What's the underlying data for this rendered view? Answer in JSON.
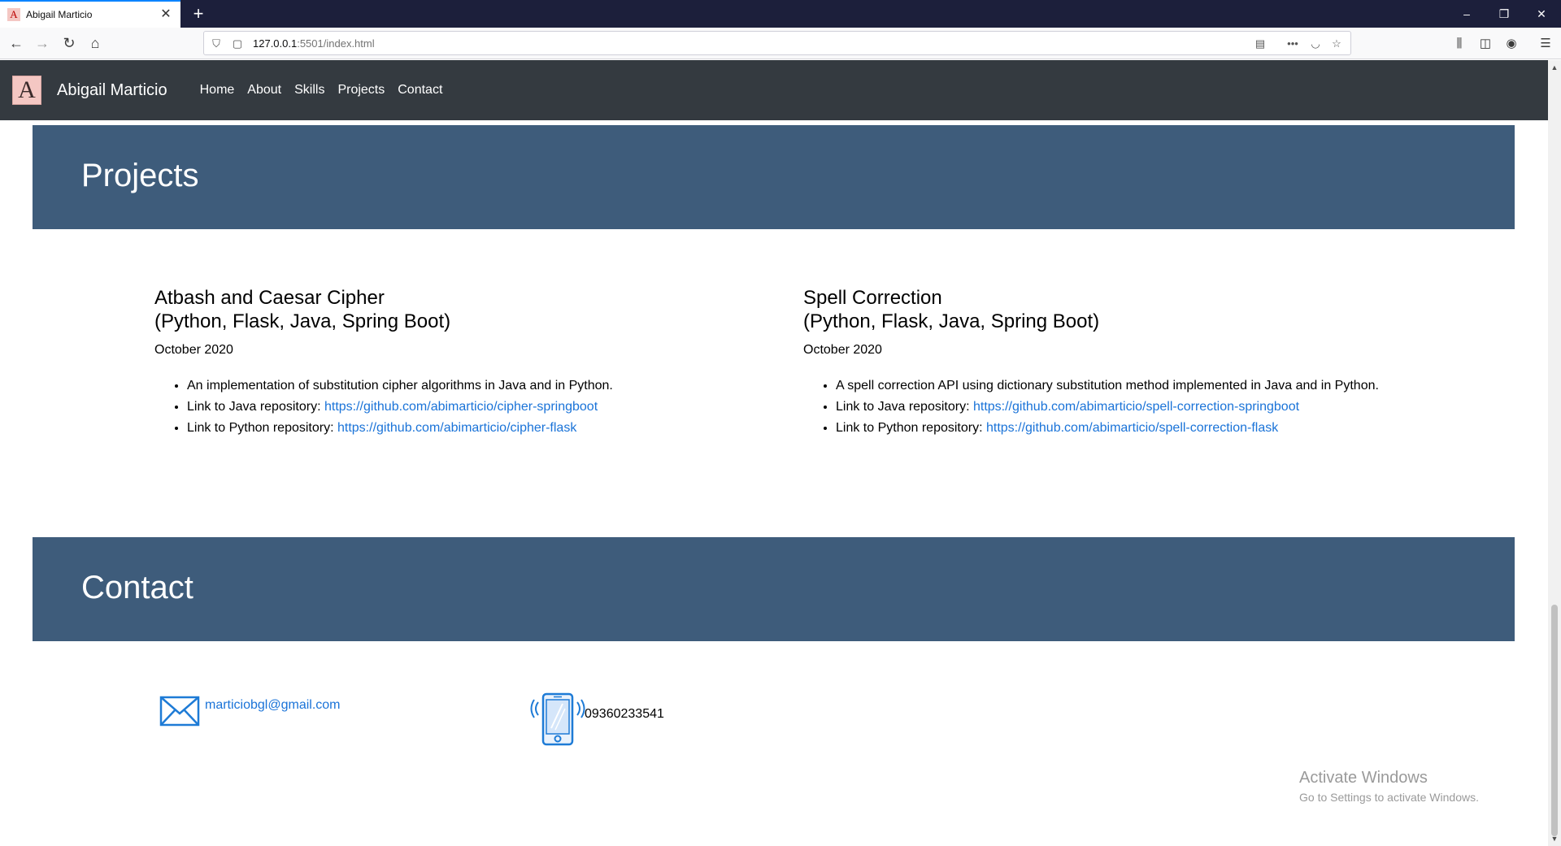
{
  "browser": {
    "tab_title": "Abigail Marticio",
    "tab_favicon_letter": "A",
    "url_host": "127.0.0.1",
    "url_rest": ":5501/index.html"
  },
  "site": {
    "brand": "Abigail Marticio",
    "logo_letter": "A",
    "nav": [
      "Home",
      "About",
      "Skills",
      "Projects",
      "Contact"
    ]
  },
  "projects_section": {
    "heading": "Projects",
    "items": [
      {
        "title_line1": "Atbash and Caesar Cipher",
        "title_line2": "(Python, Flask, Java, Spring Boot)",
        "date": "October 2020",
        "bullet1": "An implementation of substitution cipher algorithms in Java and in Python.",
        "bullet2_label": "Link to Java repository: ",
        "bullet2_link": "https://github.com/abimarticio/cipher-springboot",
        "bullet3_label": "Link to Python repository: ",
        "bullet3_link": "https://github.com/abimarticio/cipher-flask"
      },
      {
        "title_line1": "Spell Correction",
        "title_line2": "(Python, Flask, Java, Spring Boot)",
        "date": "October 2020",
        "bullet1": "A spell correction API using dictionary substitution method implemented in Java and in Python.",
        "bullet2_label": "Link to Java repository: ",
        "bullet2_link": "https://github.com/abimarticio/spell-correction-springboot",
        "bullet3_label": "Link to Python repository: ",
        "bullet3_link": "https://github.com/abimarticio/spell-correction-flask"
      }
    ]
  },
  "contact_section": {
    "heading": "Contact",
    "email": "marticiobgl@gmail.com",
    "phone": "09360233541"
  },
  "watermark": {
    "line1": "Activate Windows",
    "line2": "Go to Settings to activate Windows."
  },
  "colors": {
    "navbar": "#343a40",
    "section_header": "#3e5c7b",
    "link": "#1a73d8",
    "icon_blue": "#1e7bd6"
  }
}
